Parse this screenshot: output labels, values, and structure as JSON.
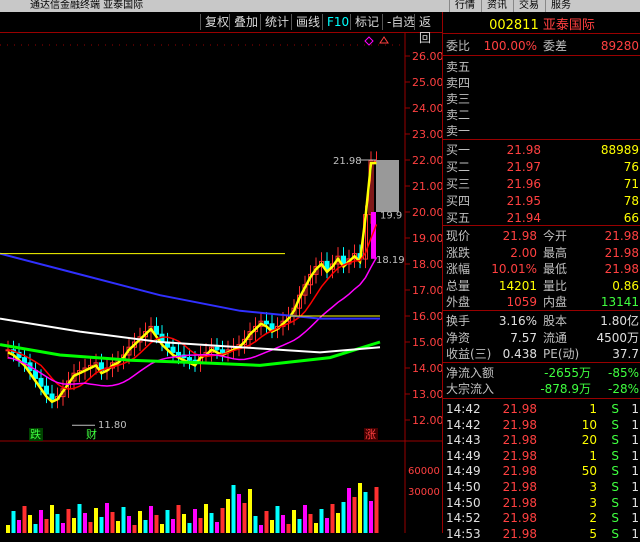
{
  "app": {
    "title": "通达信金融终端 亚泰国际",
    "menus": [
      "行情",
      "资讯",
      "交易",
      "服务"
    ]
  },
  "toolbar": {
    "buttons": [
      "复权",
      "叠加",
      "统计",
      "画线",
      "F10",
      "标记",
      "-自选",
      "返回"
    ]
  },
  "chart": {
    "price_axis": [
      "26.00",
      "25.00",
      "24.00",
      "23.00",
      "22.00",
      "21.00",
      "20.00",
      "19.00",
      "18.00",
      "17.00",
      "16.00",
      "15.00",
      "14.00",
      "13.00",
      "12.00"
    ],
    "volume_axis": [
      "60000",
      "30000"
    ],
    "high_marker": "21.98",
    "low_marker": "11.80",
    "tag_199": "19.9",
    "tag_1819": "18.19",
    "signals": {
      "down": "跌",
      "fin": "财",
      "up": "涨"
    },
    "colors": {
      "up": "#ff3030",
      "down": "#00ffff",
      "ma5": "#ffff00",
      "ma10": "#ff0000",
      "ma20": "#ff00ff",
      "ma60": "#00ff00",
      "ma120": "#ffffff",
      "ma250": "#3030ff"
    }
  },
  "quote": {
    "code": "002811",
    "name": "亚泰国际",
    "wei_bi_label": "委比",
    "wei_bi": "100.00%",
    "wei_cha_label": "委差",
    "wei_cha": "89280",
    "sells": [
      {
        "label": "卖五",
        "price": "",
        "vol": ""
      },
      {
        "label": "卖四",
        "price": "",
        "vol": ""
      },
      {
        "label": "卖三",
        "price": "",
        "vol": ""
      },
      {
        "label": "卖二",
        "price": "",
        "vol": ""
      },
      {
        "label": "卖一",
        "price": "",
        "vol": ""
      }
    ],
    "buys": [
      {
        "label": "买一",
        "price": "21.98",
        "vol": "88989"
      },
      {
        "label": "买二",
        "price": "21.97",
        "vol": "76"
      },
      {
        "label": "买三",
        "price": "21.96",
        "vol": "71"
      },
      {
        "label": "买四",
        "price": "21.95",
        "vol": "78"
      },
      {
        "label": "买五",
        "price": "21.94",
        "vol": "66"
      }
    ],
    "stats1": [
      {
        "l1": "现价",
        "v1": "21.98",
        "l2": "今开",
        "v2": "21.98"
      },
      {
        "l1": "涨跌",
        "v1": "2.00",
        "l2": "最高",
        "v2": "21.98"
      },
      {
        "l1": "涨幅",
        "v1": "10.01%",
        "l2": "最低",
        "v2": "21.98"
      },
      {
        "l1": "总量",
        "v1": "14201",
        "l2": "量比",
        "v2": "0.86"
      },
      {
        "l1": "外盘",
        "v1": "1059",
        "l2": "内盘",
        "v2": "13141"
      }
    ],
    "stats2": [
      {
        "l1": "换手",
        "v1": "3.16%",
        "l2": "股本",
        "v2": "1.80亿"
      },
      {
        "l1": "净资",
        "v1": "7.57",
        "l2": "流通",
        "v2": "4500万"
      },
      {
        "l1": "收益(三)",
        "v1": "0.438",
        "l2": "PE(动)",
        "v2": "37.7"
      }
    ],
    "flows": [
      {
        "label": "净流入额",
        "val": "-2655万",
        "pct": "-85%"
      },
      {
        "label": "大宗流入",
        "val": "-878.9万",
        "pct": "-28%"
      }
    ],
    "ticks": [
      {
        "time": "14:42",
        "price": "21.98",
        "vol": "1",
        "side": "S",
        "n": "1"
      },
      {
        "time": "14:42",
        "price": "21.98",
        "vol": "10",
        "side": "S",
        "n": "1"
      },
      {
        "time": "14:43",
        "price": "21.98",
        "vol": "20",
        "side": "S",
        "n": "1"
      },
      {
        "time": "14:49",
        "price": "21.98",
        "vol": "1",
        "side": "S",
        "n": "1"
      },
      {
        "time": "14:49",
        "price": "21.98",
        "vol": "50",
        "side": "S",
        "n": "1"
      },
      {
        "time": "14:50",
        "price": "21.98",
        "vol": "3",
        "side": "S",
        "n": "1"
      },
      {
        "time": "14:50",
        "price": "21.98",
        "vol": "3",
        "side": "S",
        "n": "1"
      },
      {
        "time": "14:52",
        "price": "21.98",
        "vol": "2",
        "side": "S",
        "n": "1"
      },
      {
        "time": "14:53",
        "price": "21.98",
        "vol": "5",
        "side": "S",
        "n": "1"
      }
    ]
  }
}
